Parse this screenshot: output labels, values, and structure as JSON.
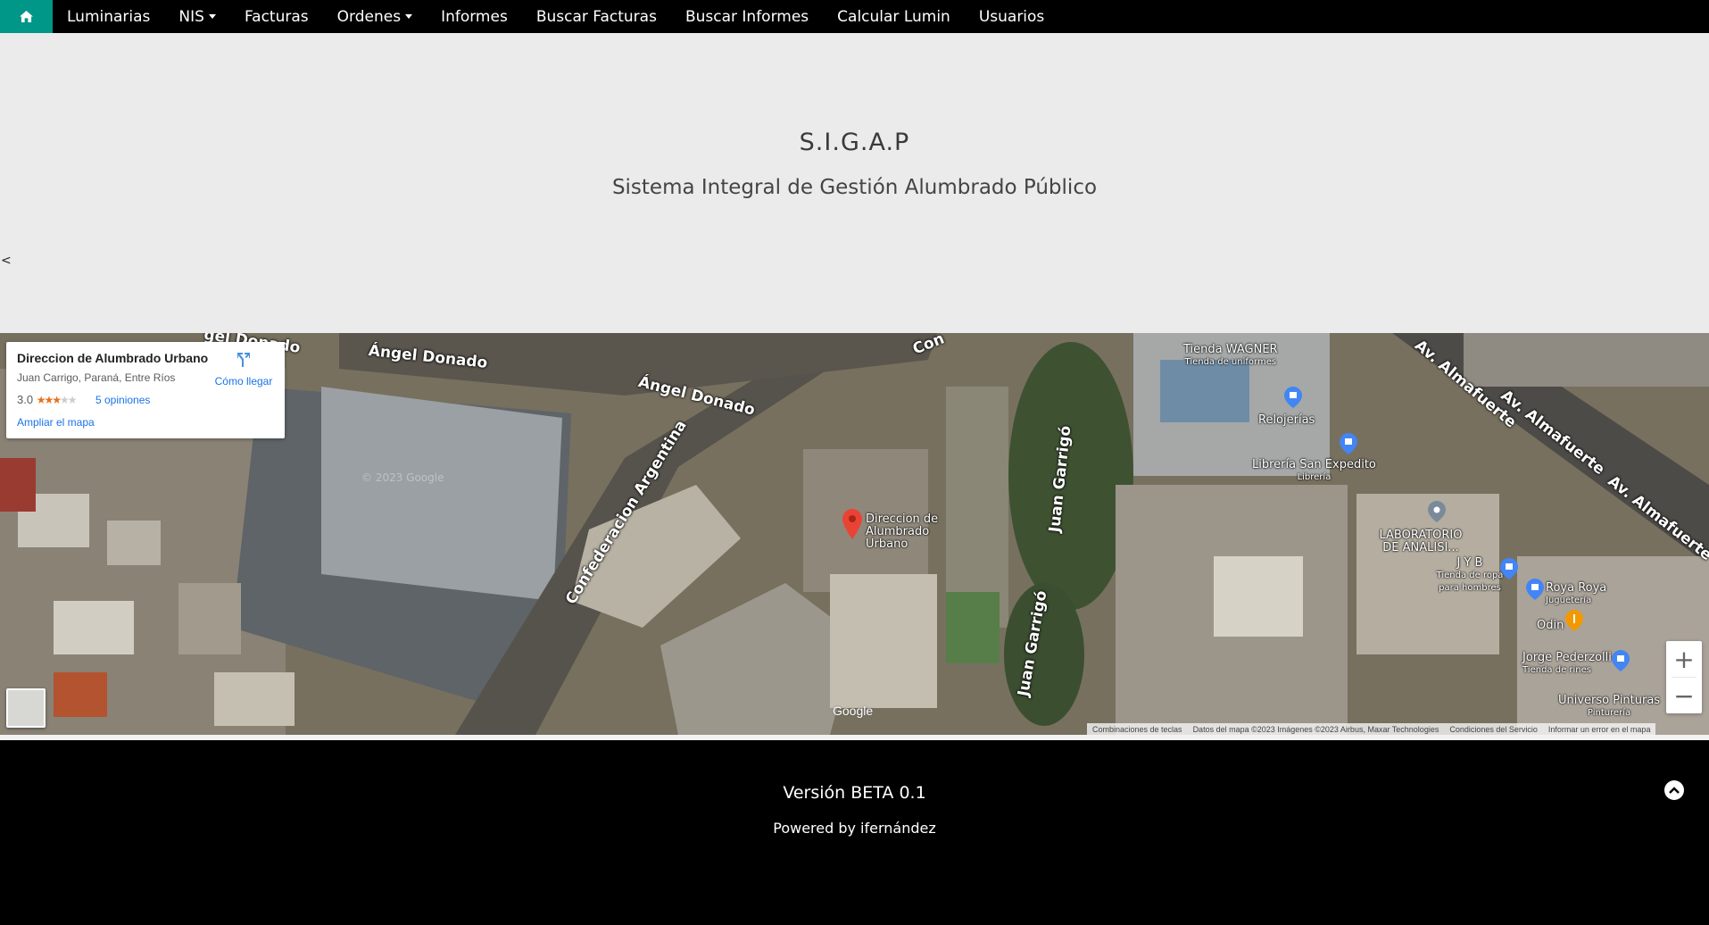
{
  "nav": {
    "items": [
      {
        "label": "Luminarias",
        "dropdown": false
      },
      {
        "label": "NIS",
        "dropdown": true
      },
      {
        "label": "Facturas",
        "dropdown": false
      },
      {
        "label": "Ordenes",
        "dropdown": true
      },
      {
        "label": "Informes",
        "dropdown": false
      },
      {
        "label": "Buscar Facturas",
        "dropdown": false
      },
      {
        "label": "Buscar Informes",
        "dropdown": false
      },
      {
        "label": "Calcular Lumin",
        "dropdown": false
      },
      {
        "label": "Usuarios",
        "dropdown": false
      }
    ],
    "home_icon": "home-icon",
    "accent_color": "#009688"
  },
  "hero": {
    "title": "S.I.G.A.P",
    "subtitle": "Sistema Integral de Gestión Alumbrado Público",
    "stray_text": "<"
  },
  "map": {
    "info_card": {
      "name": "Direccion de Alumbrado Urbano",
      "address": "Juan Carrigo, Paraná, Entre Ríos",
      "rating": "3.0",
      "stars_filled": 3,
      "stars_total": 5,
      "reviews": "5 opiniones",
      "directions": "Cómo llegar",
      "enlarge": "Ampliar el mapa"
    },
    "streets": {
      "angel_donado_1": "Ángel Donado",
      "angel_donado_2": "Ángel Donado",
      "confederacion": "Confederacion Argentina",
      "juan_garrigo_1": "Juan Garrigó",
      "juan_garrigo_2": "Juan Garrigó",
      "almafuerte_1": "Av. Almafuerte",
      "almafuerte_2": "Av. Almafuerte",
      "almafuerte_3": "Av. Almafuerte",
      "top_partial": "Con",
      "top_left_partial": "gel Donado"
    },
    "pois": {
      "marker": "Direccion de Alumbrado Urbano",
      "tienda_wagner": "Tienda WAGNER",
      "tienda_wagner_sub": "Tienda de uniformes",
      "relojerias": "Relojerías",
      "libreria": "Librería San Expedito",
      "libreria_sub": "Librería",
      "laboratorio": "LABORATORIO DE ANALISI...",
      "jyb": "J Y B",
      "jyb_sub": "Tienda de ropa para hombres",
      "roya": "Roya Roya",
      "roya_sub": "Juguetería",
      "odin": "Odin",
      "jorge": "Jorge Pederzolli",
      "jorge_sub": "Tienda de rines",
      "universo": "Universo Pinturas",
      "universo_sub": "Pinturería"
    },
    "watermark": "© 2023 Google",
    "google_logo": "Google",
    "zoom_in": "+",
    "zoom_out": "−",
    "attribution": [
      "Combinaciones de teclas",
      "Datos del mapa ©2023 Imágenes ©2023 Airbus, Maxar Technologies",
      "Condiciones del Servicio",
      "Informar un error en el mapa"
    ]
  },
  "footer": {
    "version": "Versión BETA 0.1",
    "powered": "Powered by ifernández",
    "scroll_icon": "chevron-up-icon"
  }
}
